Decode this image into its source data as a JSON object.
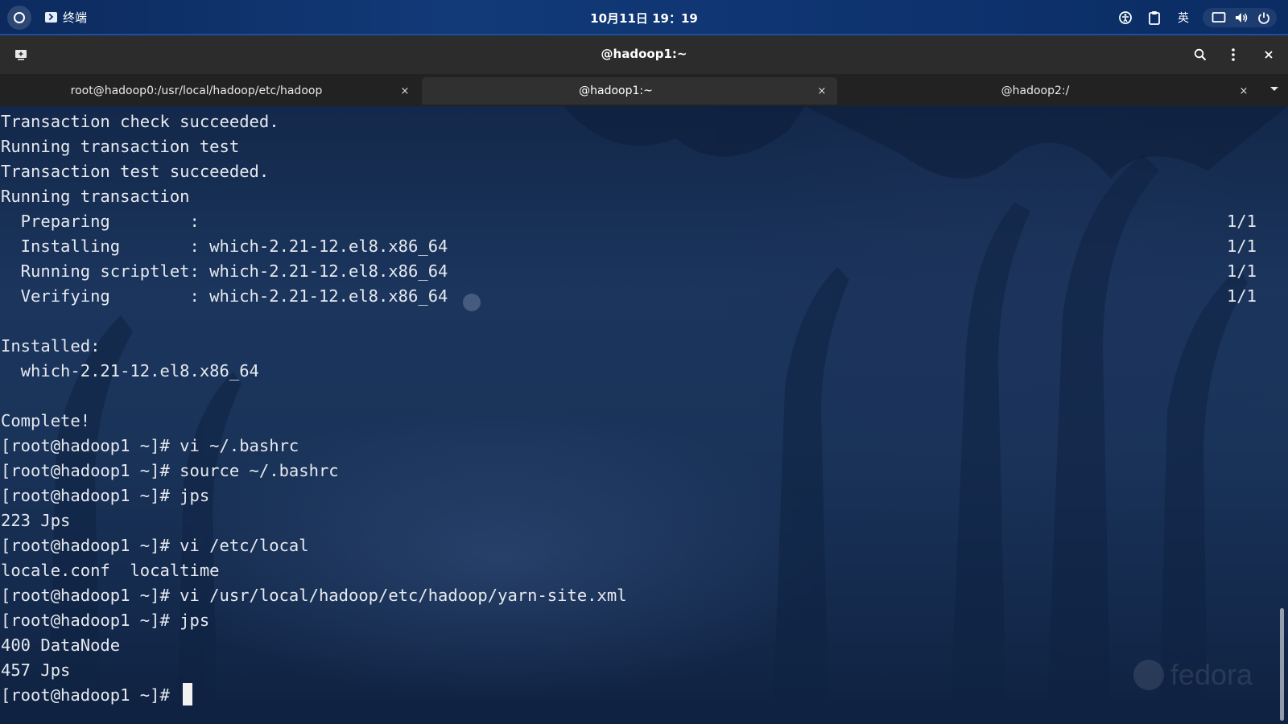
{
  "system_bar": {
    "app_name": "终端",
    "clock": "10月11日 19：19",
    "input_method": "英"
  },
  "window": {
    "title": "@hadoop1:~"
  },
  "tabs": [
    {
      "label": "root@hadoop0:/usr/local/hadoop/etc/hadoop",
      "close": "×",
      "active": false
    },
    {
      "label": "@hadoop1:~",
      "close": "×",
      "active": true
    },
    {
      "label": "@hadoop2:/",
      "close": "×",
      "active": false
    }
  ],
  "terminal": {
    "lines": [
      {
        "text": "Transaction check succeeded.",
        "right": ""
      },
      {
        "text": "Running transaction test",
        "right": ""
      },
      {
        "text": "Transaction test succeeded.",
        "right": ""
      },
      {
        "text": "Running transaction",
        "right": ""
      },
      {
        "text": "  Preparing        :",
        "right": "1/1"
      },
      {
        "text": "  Installing       : which-2.21-12.el8.x86_64",
        "right": "1/1"
      },
      {
        "text": "  Running scriptlet: which-2.21-12.el8.x86_64",
        "right": "1/1"
      },
      {
        "text": "  Verifying        : which-2.21-12.el8.x86_64",
        "right": "1/1"
      },
      {
        "text": "",
        "right": ""
      },
      {
        "text": "Installed:",
        "right": ""
      },
      {
        "text": "  which-2.21-12.el8.x86_64",
        "right": ""
      },
      {
        "text": "",
        "right": ""
      },
      {
        "text": "Complete!",
        "right": ""
      },
      {
        "text": "[root@hadoop1 ~]# vi ~/.bashrc",
        "right": ""
      },
      {
        "text": "[root@hadoop1 ~]# source ~/.bashrc",
        "right": ""
      },
      {
        "text": "[root@hadoop1 ~]# jps",
        "right": ""
      },
      {
        "text": "223 Jps",
        "right": ""
      },
      {
        "text": "[root@hadoop1 ~]# vi /etc/local",
        "right": ""
      },
      {
        "text": "locale.conf  localtime",
        "right": ""
      },
      {
        "text": "[root@hadoop1 ~]# vi /usr/local/hadoop/etc/hadoop/yarn-site.xml",
        "right": ""
      },
      {
        "text": "[root@hadoop1 ~]# jps",
        "right": ""
      },
      {
        "text": "400 DataNode",
        "right": ""
      },
      {
        "text": "457 Jps",
        "right": ""
      }
    ],
    "prompt": "[root@hadoop1 ~]# ",
    "watermark": "fedora"
  },
  "icons": {
    "activities": "activities-icon",
    "app": "terminal-app-icon",
    "new_tab": "new-tab-icon",
    "search": "search-icon",
    "menu": "kebab-menu-icon",
    "close": "close-icon",
    "tabs_dropdown": "chevron-down-icon",
    "tray": [
      "accessibility-icon",
      "clipboard-icon",
      "display-icon",
      "volume-icon",
      "power-icon"
    ]
  },
  "colors": {
    "top_bar": "#123a78",
    "header": "#2c2c2c",
    "terminal_text": "#e6e9ef",
    "terminal_bg": "#1b355d"
  }
}
